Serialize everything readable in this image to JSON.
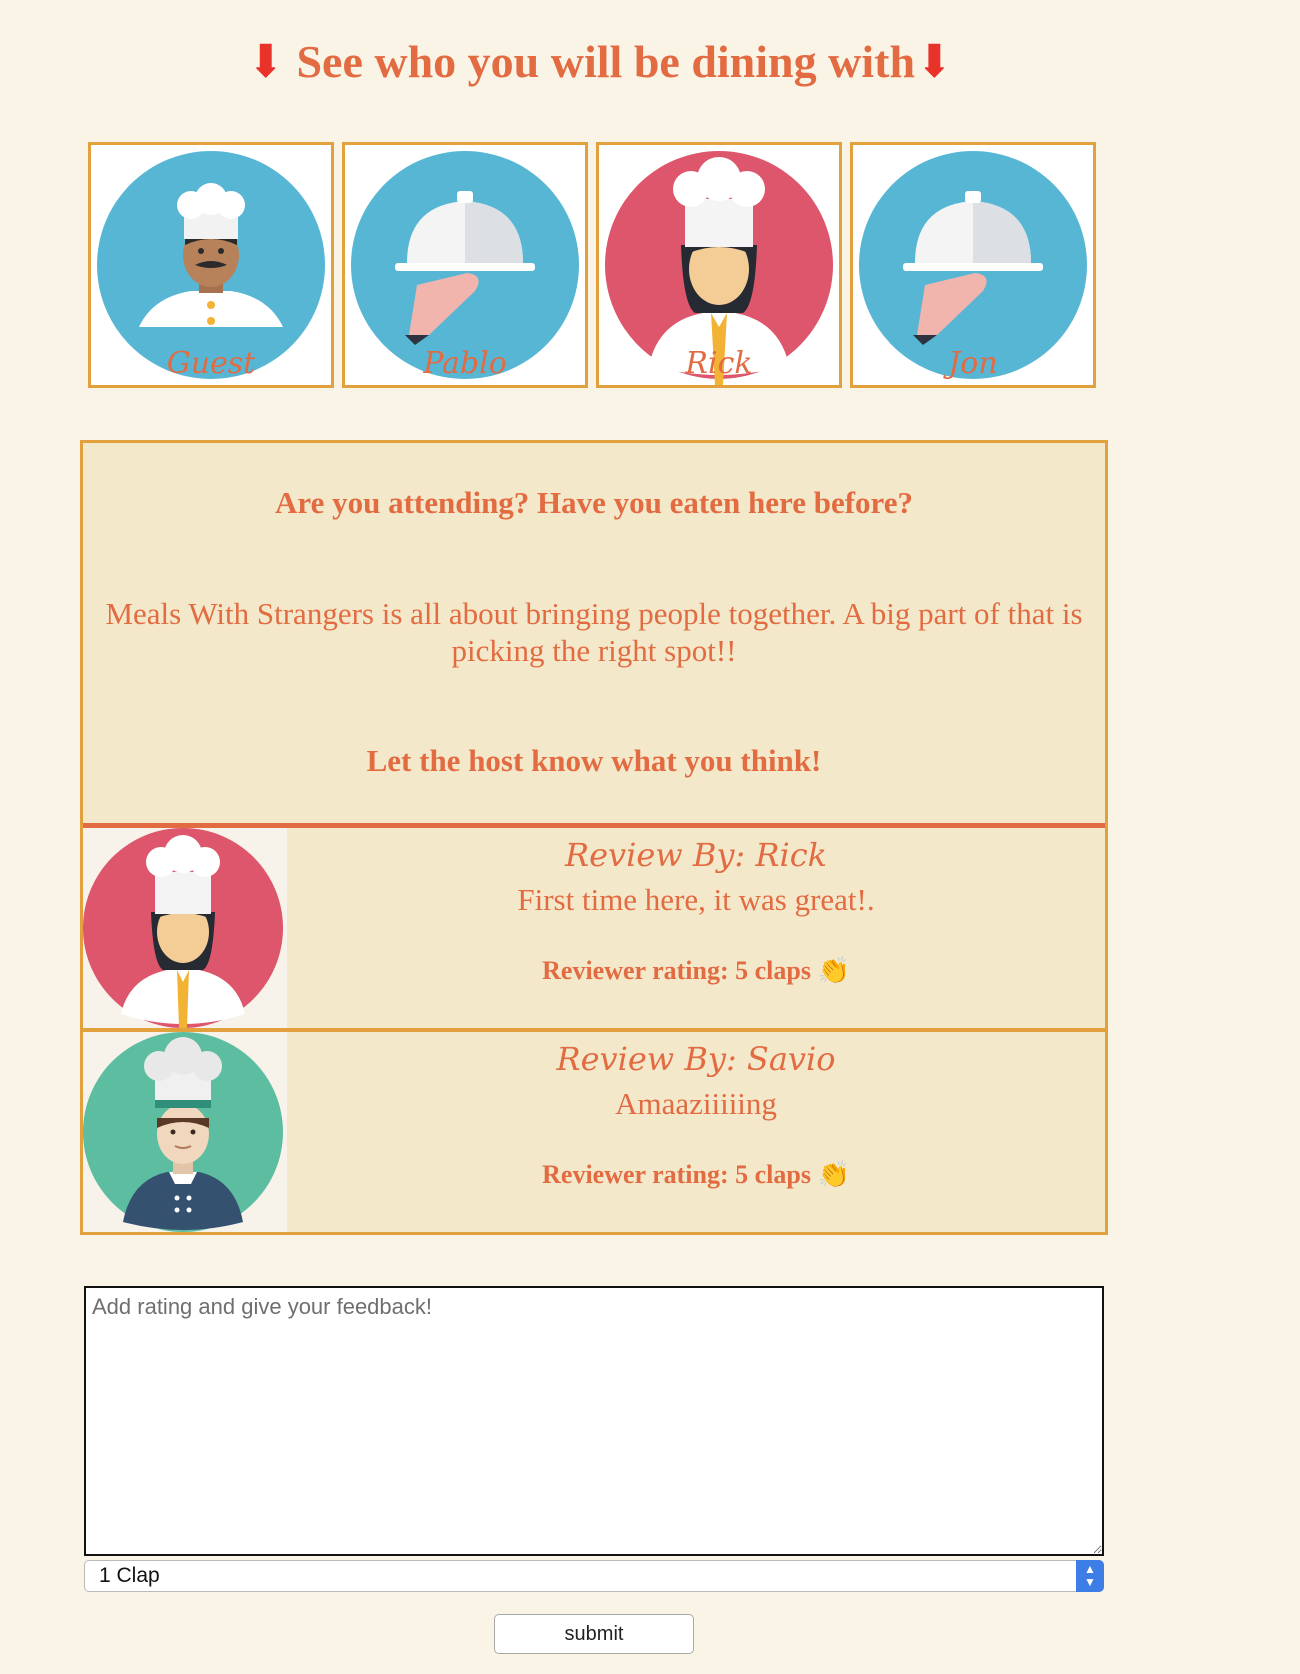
{
  "header": {
    "title": "See who you will be dining with",
    "arrow_left": "⬇",
    "arrow_right": "⬇"
  },
  "diners": [
    {
      "name": "Guest",
      "avatar": "chef-man-icon",
      "bg": "#58b6d5"
    },
    {
      "name": "Pablo",
      "avatar": "cloche-icon",
      "bg": "#58b6d5"
    },
    {
      "name": "Rick",
      "avatar": "chef-woman-icon",
      "bg": "#dd566b"
    },
    {
      "name": "Jon",
      "avatar": "cloche-icon",
      "bg": "#58b6d5"
    }
  ],
  "intro": {
    "question": "Are you attending? Have you eaten here before?",
    "body": "Meals With Strangers is all about bringing people together. A big part of that is picking the right spot!!",
    "cta": "Let the host know what you think!"
  },
  "reviews": [
    {
      "by": "Review By: Rick",
      "text": "First time here, it was great!.",
      "rating": "Reviewer rating: 5 claps 👏",
      "avatar": "chef-woman-icon"
    },
    {
      "by": "Review By: Savio",
      "text": "Amaaziiiiing",
      "rating": "Reviewer rating: 5 claps 👏",
      "avatar": "chef-man-green-icon"
    }
  ],
  "form": {
    "placeholder": "Add rating and give your feedback!",
    "rating_selected": "1 Clap",
    "submit_label": "submit"
  },
  "colors": {
    "accent": "#e26b42",
    "border": "#e3a13e",
    "panel": "#f3e8c9",
    "background": "#faf4e7"
  }
}
